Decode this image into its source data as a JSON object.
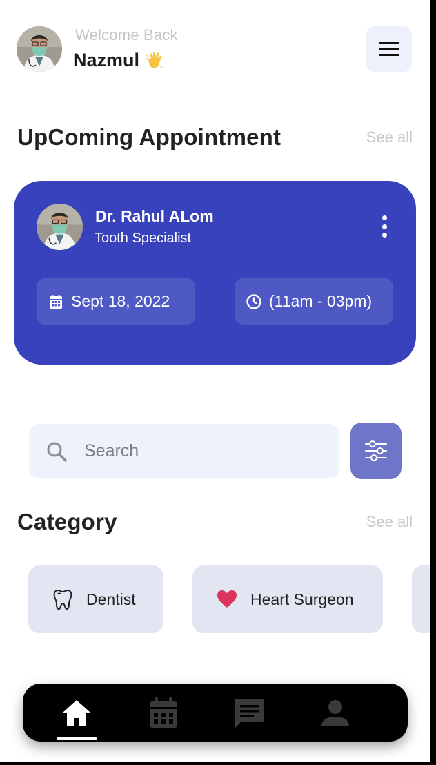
{
  "header": {
    "welcome": "Welcome Back",
    "username": "Nazmul",
    "wave_icon": "waving-hand-icon",
    "menu_icon": "hamburger-menu-icon"
  },
  "upcoming": {
    "title": "UpComing Appointment",
    "see_all": "See all",
    "doctor_name": "Dr. Rahul ALom",
    "doctor_specialty": "Tooth Specialist",
    "date": "Sept 18, 2022",
    "time": "(11am - 03pm)",
    "card_color": "#3742bc"
  },
  "search": {
    "placeholder": "Search"
  },
  "category": {
    "title": "Category",
    "see_all": "See all",
    "items": [
      {
        "label": "Dentist",
        "icon": "tooth-icon"
      },
      {
        "label": "Heart Surgeon",
        "icon": "heart-icon"
      }
    ]
  },
  "nav": {
    "items": [
      "home-icon",
      "calendar-icon",
      "chat-icon",
      "profile-icon"
    ],
    "active": "home-icon"
  }
}
